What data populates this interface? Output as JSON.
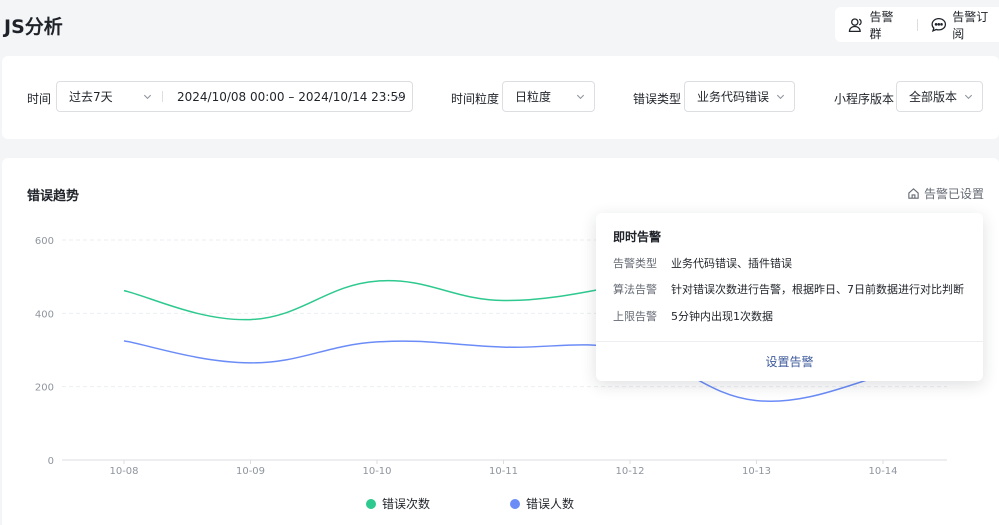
{
  "app": {
    "title": "JS分析"
  },
  "top_actions": {
    "alert_group": "告警群",
    "alert_subscribe": "告警订阅"
  },
  "filters": {
    "time_label": "时间",
    "time_range_value": "过去7天",
    "date_range_value": "2024/10/08 00:00 – 2024/10/14 23:59",
    "granularity_label": "时间粒度",
    "granularity_value": "日粒度",
    "error_type_label": "错误类型",
    "error_type_value": "业务代码错误",
    "version_label": "小程序版本",
    "version_value": "全部版本"
  },
  "chart_section": {
    "title": "错误趋势",
    "alert_status": "告警已设置"
  },
  "popover": {
    "title": "即时告警",
    "rows": [
      {
        "key": "告警类型",
        "value": "业务代码错误、插件错误"
      },
      {
        "key": "算法告警",
        "value": "针对错误次数进行告警，根据昨日、7日前数据进行对比判断"
      },
      {
        "key": "上限告警",
        "value": "5分钟内出现1次数据"
      }
    ],
    "action": "设置告警"
  },
  "colors": {
    "series_green": "#2ec98f",
    "series_blue": "#6b8cf7",
    "accent": "#3d5a9c"
  },
  "chart_data": {
    "type": "line",
    "categories": [
      "10-08",
      "10-09",
      "10-10",
      "10-11",
      "10-12",
      "10-13",
      "10-14"
    ],
    "ylim": [
      0,
      600
    ],
    "yticks": [
      0,
      200,
      400,
      600
    ],
    "grid": true,
    "legend_position": "bottom",
    "series": [
      {
        "name": "错误次数",
        "color": "#2ec98f",
        "values": [
          462,
          383,
          488,
          435,
          480,
          null,
          null
        ]
      },
      {
        "name": "错误人数",
        "color": "#6b8cf7",
        "values": [
          325,
          265,
          322,
          308,
          300,
          162,
          230
        ]
      }
    ]
  }
}
